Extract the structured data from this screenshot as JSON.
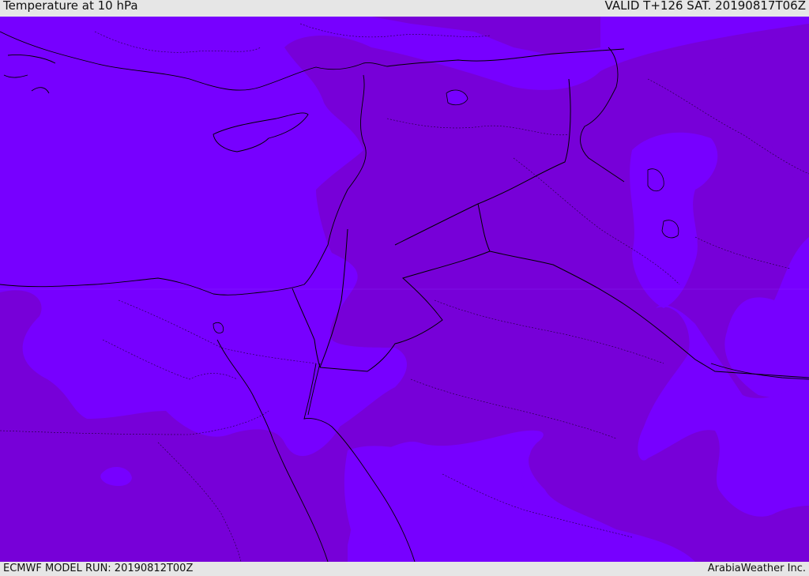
{
  "header": {
    "title": "Temperature at 10 hPa",
    "valid_time": "VALID T+126 SAT. 20190817T06Z"
  },
  "footer": {
    "model_run": "ECMWF MODEL RUN: 20190812T00Z",
    "credit": "ArabiaWeather Inc."
  },
  "map": {
    "colors": {
      "field_light": "#7700ff",
      "field_dark": "#7700d8",
      "coastline": "#000000",
      "border": "#000000"
    }
  }
}
